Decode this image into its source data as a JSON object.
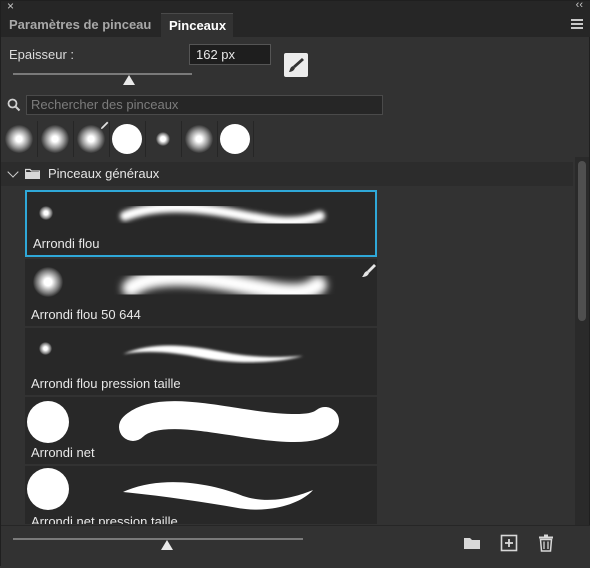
{
  "window": {
    "close_glyph": "×",
    "collapse_glyph": "‹‹"
  },
  "tabs": [
    {
      "label": "Paramètres de pinceau",
      "active": false
    },
    {
      "label": "Pinceaux",
      "active": true
    }
  ],
  "size": {
    "label": "Epaisseur :",
    "value": "162 px",
    "slider_fraction": 0.65
  },
  "search": {
    "placeholder": "Rechercher des pinceaux",
    "icon": "search-icon"
  },
  "recent_brushes": [
    {
      "type": "soft"
    },
    {
      "type": "soft"
    },
    {
      "type": "soft",
      "pressure_pen": true
    },
    {
      "type": "hard"
    },
    {
      "type": "soft-small"
    },
    {
      "type": "soft"
    },
    {
      "type": "hard"
    }
  ],
  "group": {
    "label": "Pinceaux généraux",
    "icon": "folder-icon",
    "expanded": true
  },
  "brushes": [
    {
      "label": "Arrondi flou",
      "selected": true,
      "tip": "soft-small"
    },
    {
      "label": "Arrondi flou 50 644",
      "selected": false,
      "tip": "soft-large",
      "pen": true
    },
    {
      "label": "Arrondi flou pression taille",
      "selected": false,
      "tip": "soft-small"
    },
    {
      "label": "Arrondi net",
      "selected": false,
      "tip": "hard"
    },
    {
      "label": "Arrondi net pression taille",
      "selected": false,
      "tip": "hard"
    }
  ],
  "bottom": {
    "preview_slider_fraction": 0.53,
    "icons": [
      "new-group-icon",
      "new-brush-icon",
      "delete-icon"
    ]
  },
  "colors": {
    "accent": "#2fa8d8",
    "panel": "#323232",
    "item": "#282828"
  }
}
